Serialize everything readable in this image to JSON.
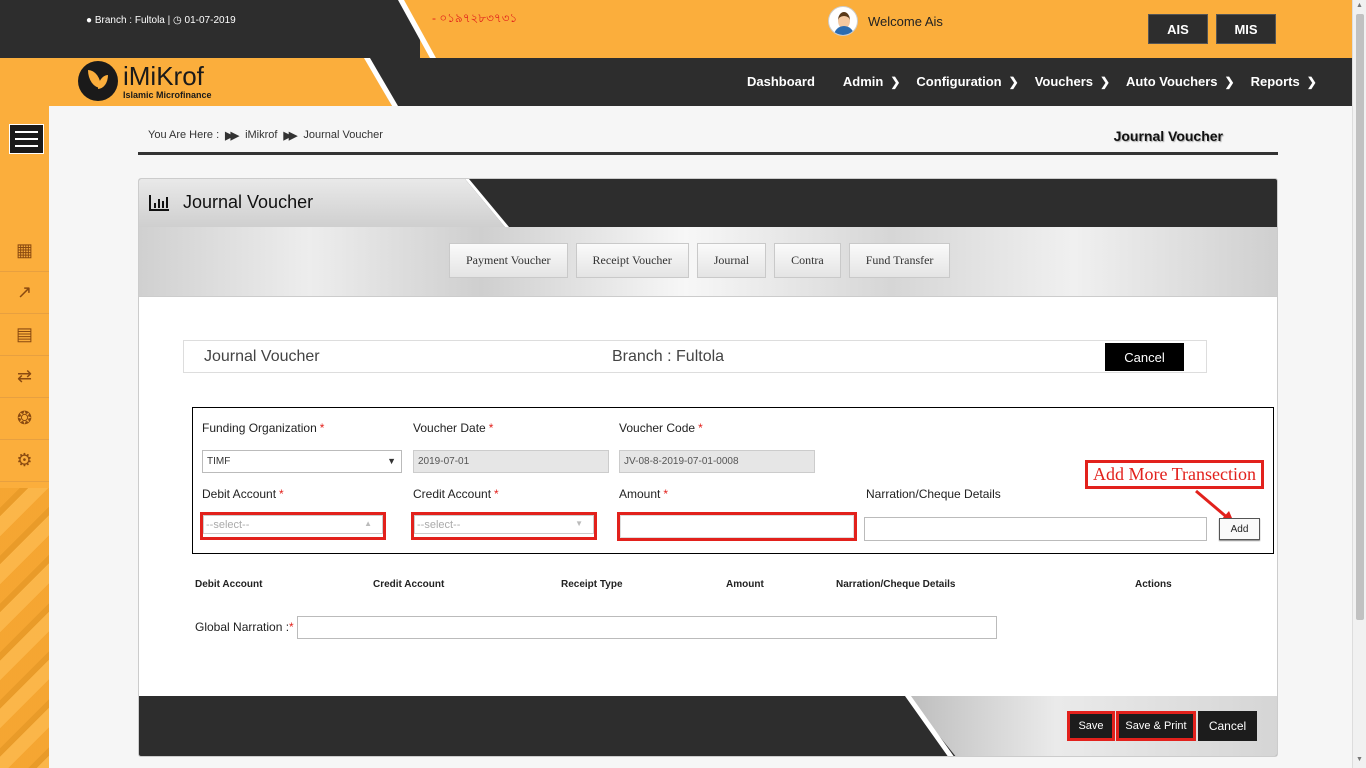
{
  "topbar": {
    "branch_text": "Branch : Fultola |",
    "date_text": "01-07-2019",
    "phone": "- ০১৯৭২৮৩৭৩১",
    "welcome": "Welcome Ais",
    "buttons": {
      "ais": "AIS",
      "mis": "MIS"
    }
  },
  "brand": {
    "name": "iMiKrof",
    "tagline": "Islamic Microfinance",
    "accent": "#fbae3c",
    "dark": "#2d2d2d"
  },
  "nav": {
    "items": [
      {
        "label": "Dashboard",
        "has_chevron": false
      },
      {
        "label": "Admin",
        "has_chevron": true
      },
      {
        "label": "Configuration",
        "has_chevron": true
      },
      {
        "label": "Vouchers",
        "has_chevron": true
      },
      {
        "label": "Auto Vouchers",
        "has_chevron": true
      },
      {
        "label": "Reports",
        "has_chevron": true
      }
    ]
  },
  "sidebar": {
    "icons": [
      "building-icon",
      "growth-chart-icon",
      "printer-icon",
      "handshake-icon",
      "settings-gears-icon",
      "process-gear-icon"
    ]
  },
  "breadcrumb": {
    "prefix": "You Are Here  :",
    "items": [
      "iMikrof",
      "Journal Voucher"
    ],
    "page_heading": "Journal Voucher"
  },
  "card": {
    "title": "Journal Voucher",
    "tabs": [
      "Payment Voucher",
      "Receipt Voucher",
      "Journal",
      "Contra",
      "Fund Transfer"
    ]
  },
  "info_bar": {
    "title": "Journal Voucher",
    "branch": "Branch : Fultola",
    "cancel": "Cancel"
  },
  "form": {
    "funding_org": {
      "label": "Funding Organization",
      "value": "TIMF"
    },
    "voucher_date": {
      "label": "Voucher Date",
      "value": "2019-07-01"
    },
    "voucher_code": {
      "label": "Voucher Code",
      "value": "JV-08-8-2019-07-01-0008"
    },
    "debit_account": {
      "label": "Debit Account",
      "placeholder": "--select--"
    },
    "credit_account": {
      "label": "Credit Account",
      "placeholder": "--select--"
    },
    "amount": {
      "label": "Amount",
      "value": ""
    },
    "narration": {
      "label": "Narration/Cheque Details",
      "value": ""
    },
    "add_button": "Add",
    "required_mark": "*"
  },
  "annotation": {
    "text": "Add More Transection",
    "color": "#e2211c"
  },
  "table": {
    "columns": [
      "Debit Account",
      "Credit Account",
      "Receipt Type",
      "Amount",
      "Narration/Cheque Details",
      "Actions"
    ]
  },
  "global_narration": {
    "label": "Global Narration :",
    "required_mark": "*",
    "value": ""
  },
  "footer": {
    "save": "Save",
    "save_print": "Save & Print",
    "cancel": "Cancel"
  }
}
